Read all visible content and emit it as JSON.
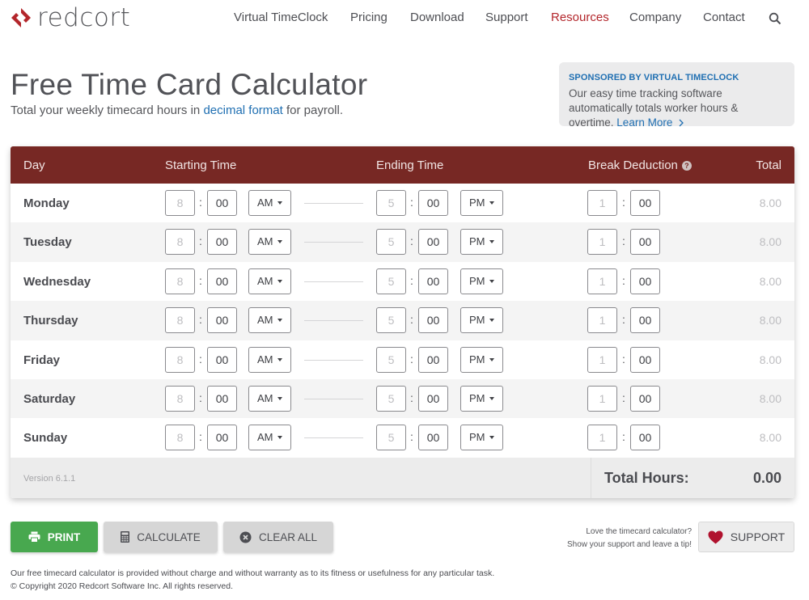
{
  "header": {
    "logo_text": "redcort",
    "nav": [
      {
        "label": "Virtual TimeClock",
        "active": false
      },
      {
        "label": "Pricing",
        "active": false
      },
      {
        "label": "Download",
        "active": false
      },
      {
        "label": "Support",
        "active": false
      },
      {
        "label": "Resources",
        "active": true
      },
      {
        "label": "Company",
        "active": false
      },
      {
        "label": "Contact",
        "active": false
      }
    ],
    "search_icon": "search-icon"
  },
  "title": {
    "heading": "Free Time Card Calculator",
    "subtitle_pre": "Total your weekly timecard hours in ",
    "subtitle_link": "decimal format",
    "subtitle_post": " for payroll."
  },
  "sponsor": {
    "heading": "SPONSORED BY VIRTUAL TIMECLOCK",
    "body": "Our easy time tracking software automatically totals worker hours & overtime.",
    "link": "Learn More",
    "link_icon": "chevron-right-icon"
  },
  "table": {
    "columns": {
      "day": "Day",
      "start": "Starting Time",
      "end": "Ending Time",
      "break": "Break Deduction",
      "total": "Total"
    },
    "help_icon": "?",
    "rows": [
      {
        "day": "Monday",
        "start_hour_placeholder": "8",
        "start_min": "00",
        "start_ampm": "AM",
        "end_hour_placeholder": "5",
        "end_min": "00",
        "end_ampm": "PM",
        "break_hour_placeholder": "1",
        "break_min": "00",
        "total": "8.00"
      },
      {
        "day": "Tuesday",
        "start_hour_placeholder": "8",
        "start_min": "00",
        "start_ampm": "AM",
        "end_hour_placeholder": "5",
        "end_min": "00",
        "end_ampm": "PM",
        "break_hour_placeholder": "1",
        "break_min": "00",
        "total": "8.00"
      },
      {
        "day": "Wednesday",
        "start_hour_placeholder": "8",
        "start_min": "00",
        "start_ampm": "AM",
        "end_hour_placeholder": "5",
        "end_min": "00",
        "end_ampm": "PM",
        "break_hour_placeholder": "1",
        "break_min": "00",
        "total": "8.00"
      },
      {
        "day": "Thursday",
        "start_hour_placeholder": "8",
        "start_min": "00",
        "start_ampm": "AM",
        "end_hour_placeholder": "5",
        "end_min": "00",
        "end_ampm": "PM",
        "break_hour_placeholder": "1",
        "break_min": "00",
        "total": "8.00"
      },
      {
        "day": "Friday",
        "start_hour_placeholder": "8",
        "start_min": "00",
        "start_ampm": "AM",
        "end_hour_placeholder": "5",
        "end_min": "00",
        "end_ampm": "PM",
        "break_hour_placeholder": "1",
        "break_min": "00",
        "total": "8.00"
      },
      {
        "day": "Saturday",
        "start_hour_placeholder": "8",
        "start_min": "00",
        "start_ampm": "AM",
        "end_hour_placeholder": "5",
        "end_min": "00",
        "end_ampm": "PM",
        "break_hour_placeholder": "1",
        "break_min": "00",
        "total": "8.00"
      },
      {
        "day": "Sunday",
        "start_hour_placeholder": "8",
        "start_min": "00",
        "start_ampm": "AM",
        "end_hour_placeholder": "5",
        "end_min": "00",
        "end_ampm": "PM",
        "break_hour_placeholder": "1",
        "break_min": "00",
        "total": "8.00"
      }
    ],
    "footer": {
      "version": "Version 6.1.1",
      "total_label": "Total Hours:",
      "total_value": "0.00"
    }
  },
  "actions": {
    "print": "PRINT",
    "calculate": "CALCULATE",
    "clear_all": "CLEAR ALL",
    "support_line1": "Love the timecard calculator?",
    "support_line2": "Show your support and leave a tip!",
    "support": "SUPPORT"
  },
  "footer": {
    "disclaimer": "Our free timecard calculator is provided without charge and without warranty as to its fitness or usefulness for any particular task.",
    "copyright": "© Copyright 2020 Redcort Software Inc. All rights reserved."
  },
  "colors": {
    "brand_red": "#b3262b",
    "table_header": "#772824",
    "link_blue": "#1f6fb2",
    "print_green": "#48a84f",
    "heart_red": "#b0122e"
  }
}
